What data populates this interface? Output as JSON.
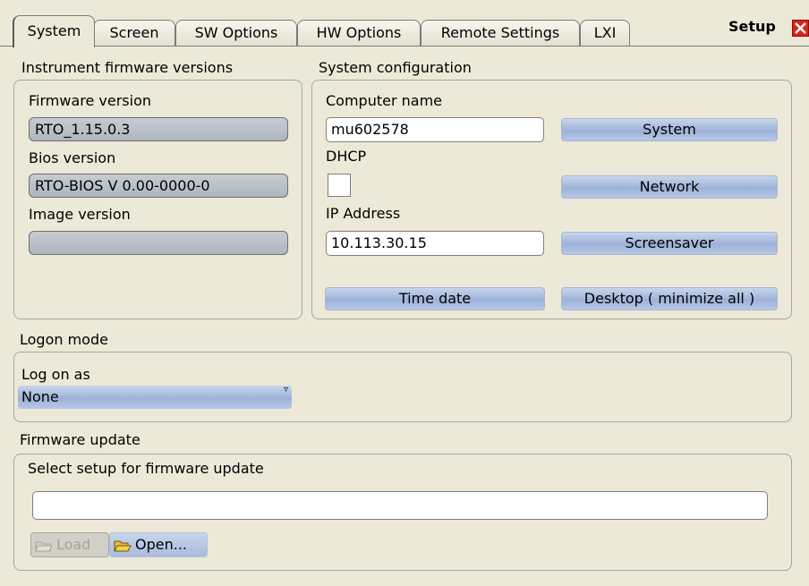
{
  "tabs": [
    "System",
    "Screen",
    "SW Options",
    "HW Options",
    "Remote Settings",
    "LXI"
  ],
  "active_tab": "System",
  "dialog": {
    "title": "Setup"
  },
  "firmware_versions": {
    "heading": "Instrument firmware versions",
    "firmware_label": "Firmware version",
    "firmware_value": "RTO_1.15.0.3",
    "bios_label": "Bios version",
    "bios_value": "RTO-BIOS V 0.00-0000-0",
    "image_label": "Image version",
    "image_value": ""
  },
  "system_config": {
    "heading": "System configuration",
    "computer_name_label": "Computer name",
    "computer_name_value": "mu602578",
    "dhcp_label": "DHCP",
    "dhcp_checked": false,
    "ip_label": "IP Address",
    "ip_value": "10.113.30.15",
    "buttons": {
      "system": "System",
      "network": "Network",
      "screensaver": "Screensaver",
      "time_date": "Time date",
      "desktop": "Desktop ( minimize all )"
    }
  },
  "logon": {
    "heading": "Logon mode",
    "label": "Log on as",
    "selected": "None"
  },
  "firmware_update": {
    "heading": "Firmware update",
    "label": "Select setup for firmware update",
    "path_value": "",
    "load_label": "Load",
    "open_label": "Open..."
  },
  "colors": {
    "background": "#ece9d8",
    "button_blue": "#9eb2d8",
    "readonly_field": "#b8c0c8",
    "close_red": "#d9241c",
    "folder_yellow": "#f2d24a"
  }
}
